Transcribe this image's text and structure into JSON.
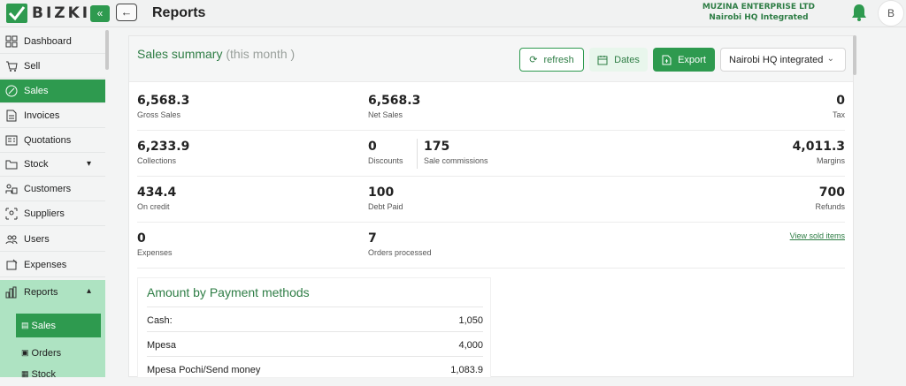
{
  "header": {
    "logo_text": "BIZKIT",
    "page_title": "Reports",
    "company_name": "MUZINA ENTERPRISE LTD",
    "branch_name": "Nairobi HQ Integrated",
    "avatar_initial": "B"
  },
  "sidebar": {
    "items": [
      {
        "label": "Dashboard",
        "icon": "grid-icon"
      },
      {
        "label": "Sell",
        "icon": "cart-icon"
      },
      {
        "label": "Sales",
        "icon": "percent-icon"
      },
      {
        "label": "Invoices",
        "icon": "document-icon"
      },
      {
        "label": "Quotations",
        "icon": "quote-icon"
      },
      {
        "label": "Stock",
        "icon": "folder-icon"
      },
      {
        "label": "Customers",
        "icon": "customers-icon"
      },
      {
        "label": "Suppliers",
        "icon": "suppliers-icon"
      },
      {
        "label": "Users",
        "icon": "users-icon"
      },
      {
        "label": "Expenses",
        "icon": "expenses-icon"
      },
      {
        "label": "Reports",
        "icon": "bar-chart-icon"
      }
    ],
    "report_sub": [
      {
        "label": "Sales",
        "icon": "sales-report-icon"
      },
      {
        "label": "Orders",
        "icon": "orders-report-icon"
      },
      {
        "label": "Stock",
        "icon": "stock-report-icon"
      }
    ]
  },
  "summary": {
    "title": "Sales summary",
    "period": "(this month )",
    "refresh_label": "refresh",
    "dates_label": "Dates",
    "export_label": "Export",
    "location": "Nairobi HQ integrated"
  },
  "stats": {
    "gross_sales": {
      "value": "6,568.3",
      "label": "Gross Sales"
    },
    "net_sales": {
      "value": "6,568.3",
      "label": "Net Sales"
    },
    "tax": {
      "value": "0",
      "label": "Tax"
    },
    "collections": {
      "value": "6,233.9",
      "label": "Collections"
    },
    "discounts": {
      "value": "0",
      "label": "Discounts"
    },
    "sale_commissions": {
      "value": "175",
      "label": "Sale commissions"
    },
    "margins": {
      "value": "4,011.3",
      "label": "Margins"
    },
    "on_credit": {
      "value": "434.4",
      "label": "On credit"
    },
    "debt_paid": {
      "value": "100",
      "label": "Debt Paid"
    },
    "refunds": {
      "value": "700",
      "label": "Refunds"
    },
    "expenses": {
      "value": "0",
      "label": "Expenses"
    },
    "orders_processed": {
      "value": "7",
      "label": "Orders processed"
    },
    "view_sold_items": "View sold items"
  },
  "payments": {
    "title": "Amount by Payment methods",
    "rows": [
      {
        "name": "Cash:",
        "amount": "1,050"
      },
      {
        "name": "Mpesa",
        "amount": "4,000"
      },
      {
        "name": "Mpesa Pochi/Send money",
        "amount": "1,083.9"
      }
    ]
  },
  "colors": {
    "accent": "#2e9a4f",
    "accent_light": "#aee3c2",
    "text_green": "#2e7d45"
  }
}
